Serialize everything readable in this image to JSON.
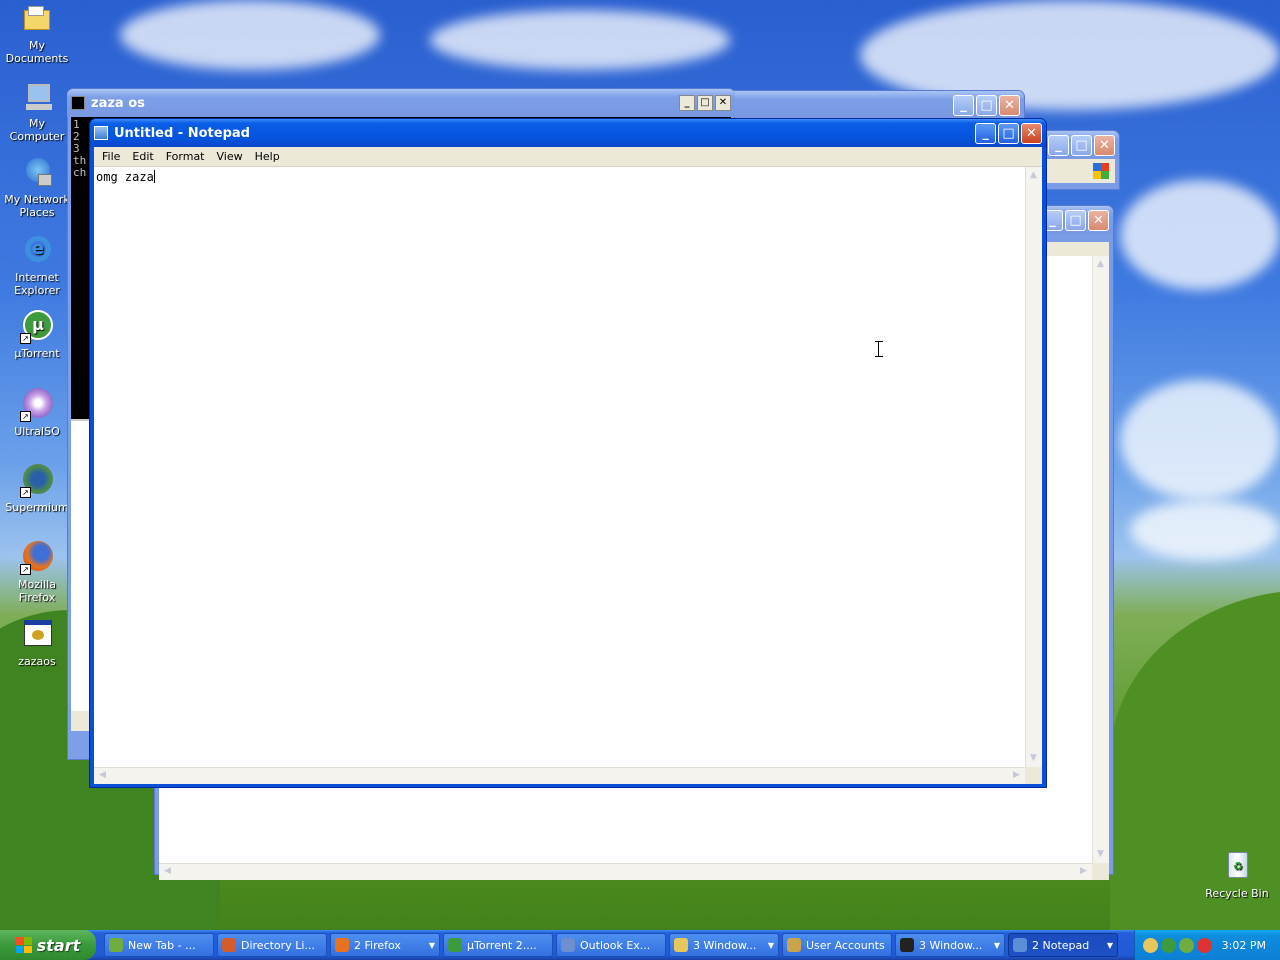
{
  "desktop": {
    "icons": [
      {
        "label": "My Documents",
        "icon": "folder-icon"
      },
      {
        "label": "My Computer",
        "icon": "computer-icon"
      },
      {
        "label": "My Network Places",
        "icon": "network-icon"
      },
      {
        "label": "Internet Explorer",
        "icon": "ie-icon"
      },
      {
        "label": "µTorrent",
        "icon": "utorrent-icon"
      },
      {
        "label": "UltraISO",
        "icon": "disc-icon"
      },
      {
        "label": "Supermium",
        "icon": "supermium-icon"
      },
      {
        "label": "Mozilla Firefox",
        "icon": "firefox-icon"
      },
      {
        "label": "zazaos",
        "icon": "program-icon"
      }
    ],
    "recycle_bin": "Recycle Bin"
  },
  "console_window": {
    "title": "zaza os",
    "lines": [
      "1",
      "2",
      "3",
      "th",
      "ch"
    ]
  },
  "notepad": {
    "title": "Untitled - Notepad",
    "menu": [
      "File",
      "Edit",
      "Format",
      "View",
      "Help"
    ],
    "content": "omg zaza"
  },
  "taskbar": {
    "start_label": "start",
    "tasks": [
      {
        "label": "New Tab - ...",
        "color": "#6fae3e"
      },
      {
        "label": "Directory Li...",
        "color": "#d35c2a"
      },
      {
        "label": "2 Firefox",
        "color": "#e8731c",
        "dropdown": true
      },
      {
        "label": "µTorrent 2....",
        "color": "#3d9b3d"
      },
      {
        "label": "Outlook Ex...",
        "color": "#6d8fcf"
      },
      {
        "label": "3 Window...",
        "color": "#e8c65a",
        "dropdown": true
      },
      {
        "label": "User Accounts",
        "color": "#c9a44a"
      },
      {
        "label": "3 Window...",
        "color": "#222222",
        "dropdown": true
      },
      {
        "label": "2 Notepad",
        "color": "#5a8fd8",
        "dropdown": true,
        "active": true
      }
    ],
    "clock": "3:02 PM"
  },
  "colors": {
    "title_active": "#0553dd",
    "title_inactive": "#7d9fe8",
    "start_green": "#3a9a3a",
    "tray_blue": "#0f8ddd"
  }
}
